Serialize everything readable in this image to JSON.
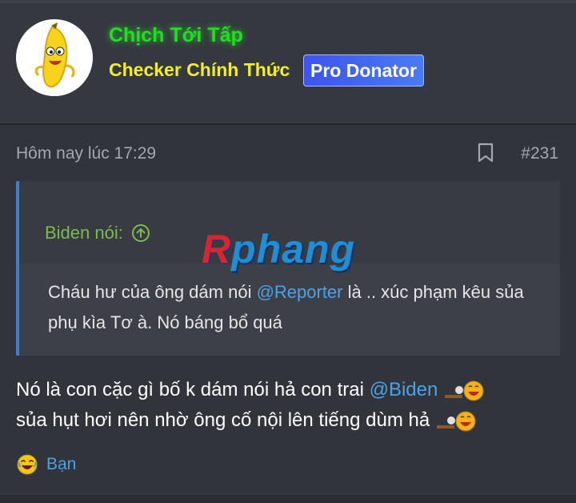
{
  "author": {
    "username": "Chịch Tới Tấp",
    "user_title": "Checker Chính Thức",
    "badge": "Pro Donator",
    "avatar_icon": "banana-avatar-icon"
  },
  "post": {
    "timestamp": "Hôm nay lúc 17:29",
    "number": "#231",
    "bookmark_icon": "bookmark-icon"
  },
  "quote": {
    "attribution": "Biden nói:",
    "body_part1": "Cháu hư của ông dám nói ",
    "mention": "@Reporter",
    "body_part2": " là .. xúc phạm kêu sủa phụ kìa Tơ à. Nó báng bổ quá"
  },
  "watermark": {
    "first_letter": "R",
    "rest": "phang"
  },
  "message": {
    "part1": "Nó là con cặc gì bố k dám nói hả con trai ",
    "mention": "@Biden",
    "part2": "sủa hụt hơi nên nhờ ông cố nội lên tiếng dùm hả"
  },
  "reaction": {
    "label": "Bạn",
    "icon": "laughing-emoji-icon"
  },
  "colors": {
    "background": "#31343b",
    "username": "#22dd22",
    "user_title": "#f3ee25",
    "badge": "#3d55ee",
    "link": "#4aa3e6",
    "quote_attrib": "#7dbb4e",
    "quote_border": "#3f7fd1"
  }
}
